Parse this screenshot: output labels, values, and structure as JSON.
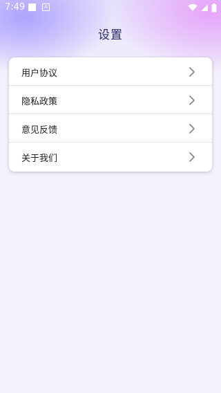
{
  "status_bar": {
    "time": "7:49",
    "notification_icons": [
      "square-icon",
      "a-icon"
    ],
    "system_icons": [
      "wifi-icon",
      "signal-icon",
      "battery-icon"
    ]
  },
  "header": {
    "title": "设置"
  },
  "settings": {
    "items": [
      {
        "label": "用户协议",
        "icon": "chevron-right-icon"
      },
      {
        "label": "隐私政策",
        "icon": "chevron-right-icon"
      },
      {
        "label": "意见反馈",
        "icon": "chevron-right-icon"
      },
      {
        "label": "关于我们",
        "icon": "chevron-right-icon"
      }
    ]
  },
  "colors": {
    "background": "#f3f1fd",
    "title_text": "#2b2a69",
    "card": "#ffffff",
    "chevron": "#8a8a8a"
  }
}
